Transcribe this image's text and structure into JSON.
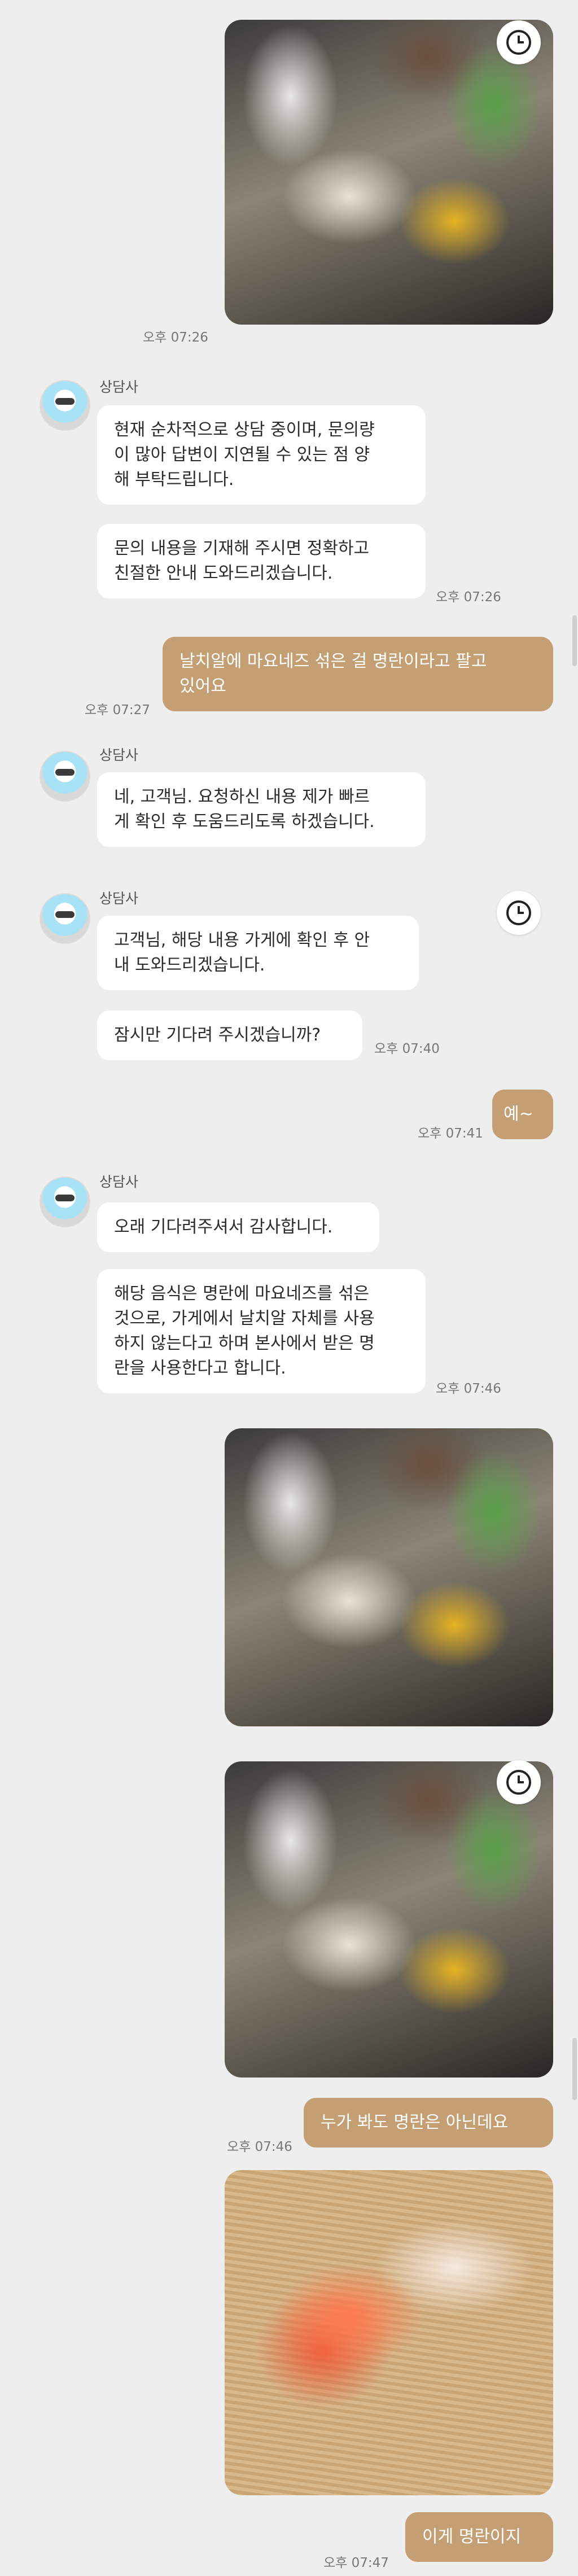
{
  "agent_name": "상담사",
  "messages": [
    {
      "text": "현재 순차적으로 상담 중이며, 문의량\n이 많아 답변이 지연될 수 있는 점 양\n해 부탁드립니다."
    },
    {
      "text": "문의 내용을 기재해 주시면 정확하고\n친절한 안내 도와드리겠습니다."
    },
    {
      "text": "날치알에 마요네즈 섞은 걸 명란이라고 팔고\n있어요"
    },
    {
      "text": "네, 고객님. 요청하신 내용 제가 빠르\n게 확인 후 도움드리도록 하겠습니다."
    },
    {
      "text": "고객님, 해당 내용 가게에 확인 후 안\n내 도와드리겠습니다."
    },
    {
      "text": "잠시만 기다려 주시겠습니까?"
    },
    {
      "text": "예~"
    },
    {
      "text": "오래 기다려주셔서 감사합니다."
    },
    {
      "text": "해당 음식은 명란에 마요네즈를 섞은\n것으로, 가게에서 날치알 자체를 사용\n하지 않는다고 하며 본사에서 받은 명\n란을 사용한다고 합니다."
    },
    {
      "text": "누가 봐도 명란은 아닌데요"
    },
    {
      "text": "이게 명란이지"
    }
  ],
  "times": [
    "오후 07:26",
    "오후 07:26",
    "오후 07:27",
    "오후 07:40",
    "오후 07:41",
    "오후 07:46",
    "오후 07:46",
    "오후 07:47"
  ]
}
